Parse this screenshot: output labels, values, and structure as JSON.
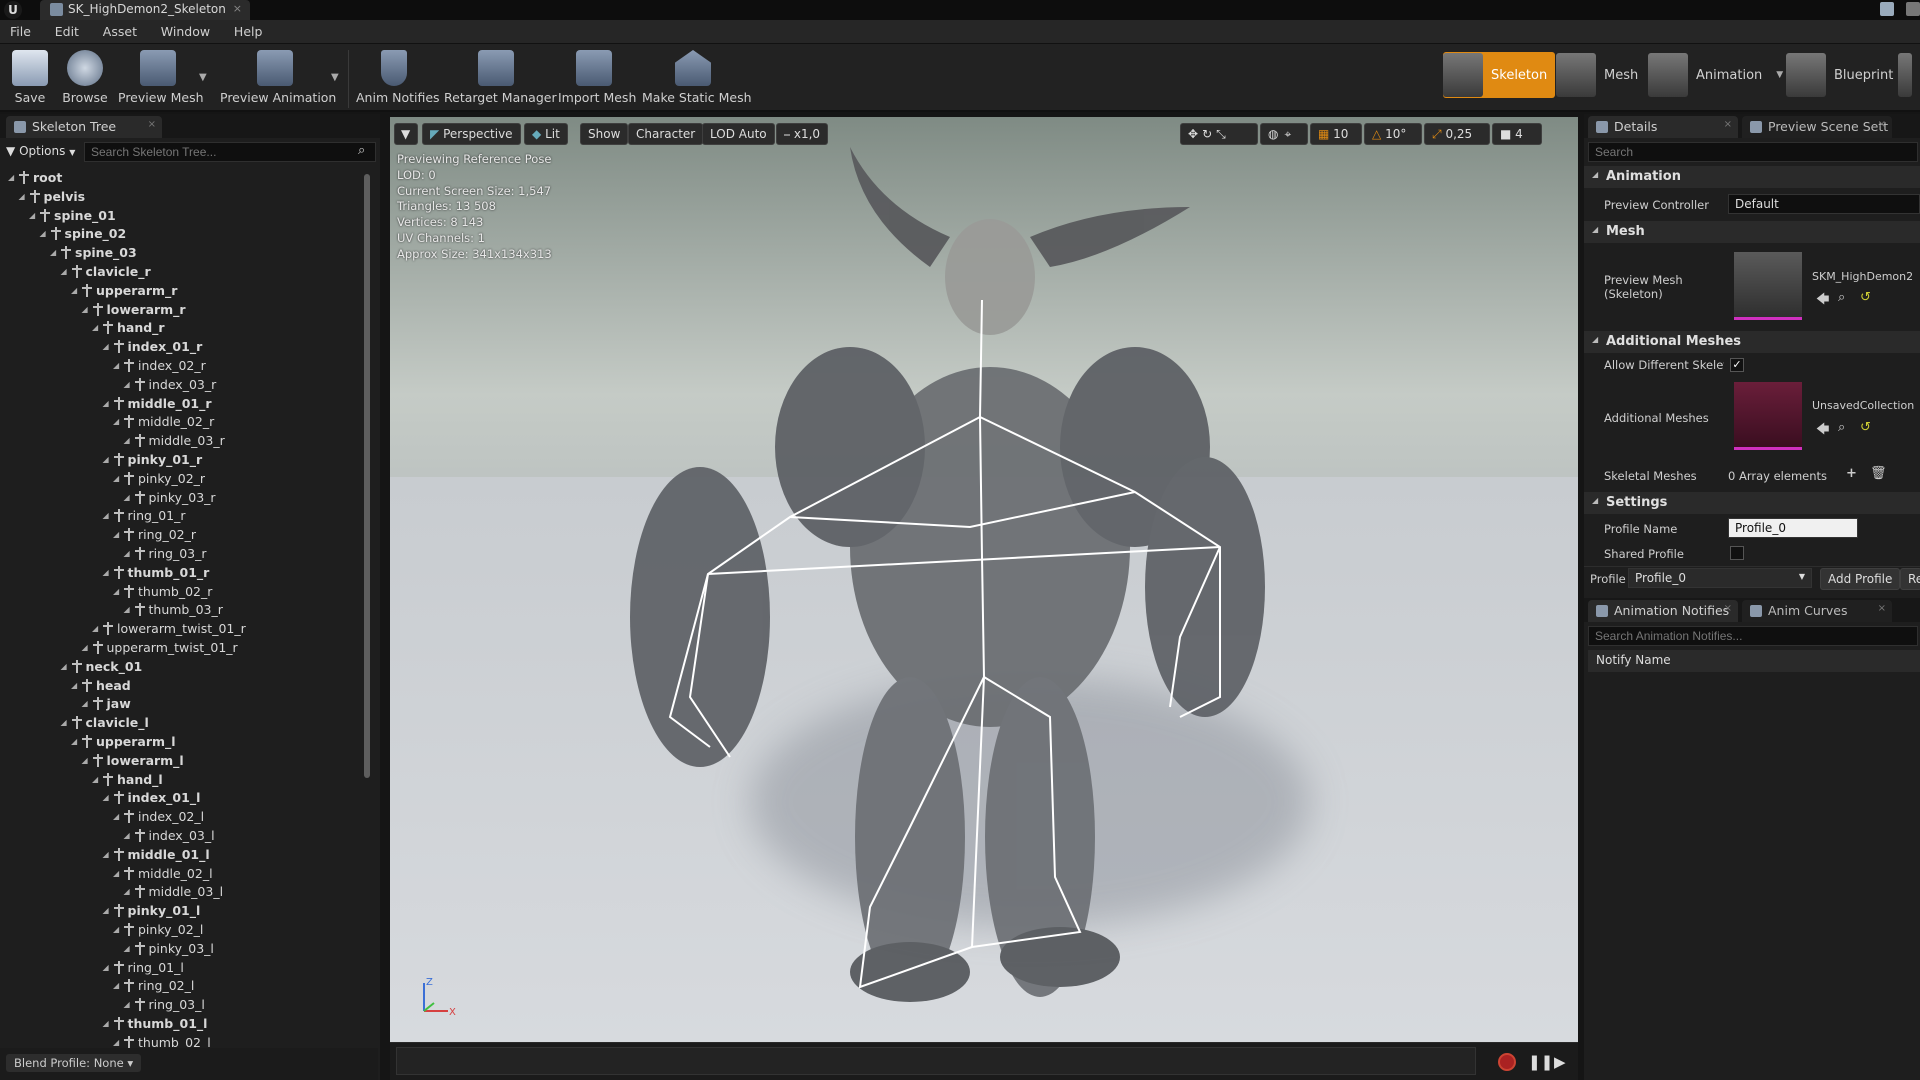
{
  "window": {
    "tab_title": "SK_HighDemon2_Skeleton",
    "logo": "U"
  },
  "menu": {
    "items": [
      "File",
      "Edit",
      "Asset",
      "Window",
      "Help"
    ]
  },
  "toolbar": {
    "buttons": [
      {
        "label": "Save",
        "icon": "save-icon"
      },
      {
        "label": "Browse",
        "icon": "browse-icon"
      },
      {
        "label": "Preview Mesh",
        "icon": "preview-mesh-icon"
      },
      {
        "label": "Preview Animation",
        "icon": "preview-animation-icon"
      },
      {
        "label": "Anim Notifies",
        "icon": "anim-notifies-icon"
      },
      {
        "label": "Retarget Manager",
        "icon": "retarget-manager-icon"
      },
      {
        "label": "Import Mesh",
        "icon": "import-mesh-icon"
      },
      {
        "label": "Make Static Mesh",
        "icon": "make-static-mesh-icon"
      }
    ],
    "modes": [
      {
        "label": "Skeleton",
        "active": true
      },
      {
        "label": "Mesh",
        "active": false
      },
      {
        "label": "Animation",
        "active": false
      },
      {
        "label": "Blueprint",
        "active": false
      }
    ]
  },
  "skeleton_tree": {
    "tab_label": "Skeleton Tree",
    "options_label": "Options",
    "search_placeholder": "Search Skeleton Tree...",
    "bones": [
      {
        "name": "root",
        "depth": 0,
        "bold": true
      },
      {
        "name": "pelvis",
        "depth": 1,
        "bold": true
      },
      {
        "name": "spine_01",
        "depth": 2,
        "bold": true
      },
      {
        "name": "spine_02",
        "depth": 3,
        "bold": true
      },
      {
        "name": "spine_03",
        "depth": 4,
        "bold": true
      },
      {
        "name": "clavicle_r",
        "depth": 5,
        "bold": true
      },
      {
        "name": "upperarm_r",
        "depth": 6,
        "bold": true
      },
      {
        "name": "lowerarm_r",
        "depth": 7,
        "bold": true
      },
      {
        "name": "hand_r",
        "depth": 8,
        "bold": true
      },
      {
        "name": "index_01_r",
        "depth": 9,
        "bold": true
      },
      {
        "name": "index_02_r",
        "depth": 10,
        "bold": false
      },
      {
        "name": "index_03_r",
        "depth": 11,
        "bold": false
      },
      {
        "name": "middle_01_r",
        "depth": 9,
        "bold": true
      },
      {
        "name": "middle_02_r",
        "depth": 10,
        "bold": false
      },
      {
        "name": "middle_03_r",
        "depth": 11,
        "bold": false
      },
      {
        "name": "pinky_01_r",
        "depth": 9,
        "bold": true
      },
      {
        "name": "pinky_02_r",
        "depth": 10,
        "bold": false
      },
      {
        "name": "pinky_03_r",
        "depth": 11,
        "bold": false
      },
      {
        "name": "ring_01_r",
        "depth": 9,
        "bold": false
      },
      {
        "name": "ring_02_r",
        "depth": 10,
        "bold": false
      },
      {
        "name": "ring_03_r",
        "depth": 11,
        "bold": false
      },
      {
        "name": "thumb_01_r",
        "depth": 9,
        "bold": true
      },
      {
        "name": "thumb_02_r",
        "depth": 10,
        "bold": false
      },
      {
        "name": "thumb_03_r",
        "depth": 11,
        "bold": false
      },
      {
        "name": "lowerarm_twist_01_r",
        "depth": 8,
        "bold": false
      },
      {
        "name": "upperarm_twist_01_r",
        "depth": 7,
        "bold": false
      },
      {
        "name": "neck_01",
        "depth": 5,
        "bold": true
      },
      {
        "name": "head",
        "depth": 6,
        "bold": true
      },
      {
        "name": "jaw",
        "depth": 7,
        "bold": true
      },
      {
        "name": "clavicle_l",
        "depth": 5,
        "bold": true
      },
      {
        "name": "upperarm_l",
        "depth": 6,
        "bold": true
      },
      {
        "name": "lowerarm_l",
        "depth": 7,
        "bold": true
      },
      {
        "name": "hand_l",
        "depth": 8,
        "bold": true
      },
      {
        "name": "index_01_l",
        "depth": 9,
        "bold": true
      },
      {
        "name": "index_02_l",
        "depth": 10,
        "bold": false
      },
      {
        "name": "index_03_l",
        "depth": 11,
        "bold": false
      },
      {
        "name": "middle_01_l",
        "depth": 9,
        "bold": true
      },
      {
        "name": "middle_02_l",
        "depth": 10,
        "bold": false
      },
      {
        "name": "middle_03_l",
        "depth": 11,
        "bold": false
      },
      {
        "name": "pinky_01_l",
        "depth": 9,
        "bold": true
      },
      {
        "name": "pinky_02_l",
        "depth": 10,
        "bold": false
      },
      {
        "name": "pinky_03_l",
        "depth": 11,
        "bold": false
      },
      {
        "name": "ring_01_l",
        "depth": 9,
        "bold": false
      },
      {
        "name": "ring_02_l",
        "depth": 10,
        "bold": false
      },
      {
        "name": "ring_03_l",
        "depth": 11,
        "bold": false
      },
      {
        "name": "thumb_01_l",
        "depth": 9,
        "bold": true
      },
      {
        "name": "thumb_02_l",
        "depth": 10,
        "bold": false
      }
    ],
    "blend_profile_label": "Blend Profile: None"
  },
  "viewport": {
    "buttons": {
      "dropdown": "▼",
      "perspective": "Perspective",
      "lit": "Lit",
      "show": "Show",
      "character": "Character",
      "lod": "LOD Auto",
      "speed": "x1,0"
    },
    "right_controls": {
      "grid_snap": "10",
      "rotation_snap": "10°",
      "scale_snap": "0,25",
      "camera_speed": "4"
    },
    "stats": [
      "Previewing Reference Pose",
      "LOD: 0",
      "Current Screen Size: 1,547",
      "Triangles: 13 508",
      "Vertices: 8 143",
      "UV Channels: 1",
      "Approx Size: 341x134x313"
    ],
    "axis": {
      "z": "Z",
      "x": "X"
    }
  },
  "details": {
    "tabs": [
      "Details",
      "Preview Scene Sett"
    ],
    "search_placeholder": "Search",
    "animation_section": "Animation",
    "preview_controller_label": "Preview Controller",
    "preview_controller_value": "Default",
    "mesh_section": "Mesh",
    "preview_mesh_label": "Preview Mesh (Skeleton)",
    "preview_mesh_value": "SKM_HighDemon2",
    "additional_meshes_section": "Additional Meshes",
    "allow_different_label": "Allow Different Skeleto",
    "allow_different_checked": "✓",
    "additional_meshes_label": "Additional Meshes",
    "additional_meshes_value": "UnsavedCollection",
    "skeletal_meshes_label": "Skeletal Meshes",
    "skeletal_meshes_value": "0 Array elements",
    "settings_section": "Settings",
    "profile_name_label": "Profile Name",
    "profile_name_value": "Profile_0",
    "shared_profile_label": "Shared Profile",
    "profile_label": "Profile",
    "profile_value": "Profile_0",
    "add_profile": "Add Profile",
    "remove_profile": "Re"
  },
  "anim_notifies": {
    "tabs": [
      "Animation Notifies",
      "Anim Curves"
    ],
    "search_placeholder": "Search Animation Notifies...",
    "column_header": "Notify Name"
  },
  "colors": {
    "accent": "#e08a12",
    "panel_bg": "#1e1e1e",
    "mesh_thumb_underline": "#d030c0"
  }
}
